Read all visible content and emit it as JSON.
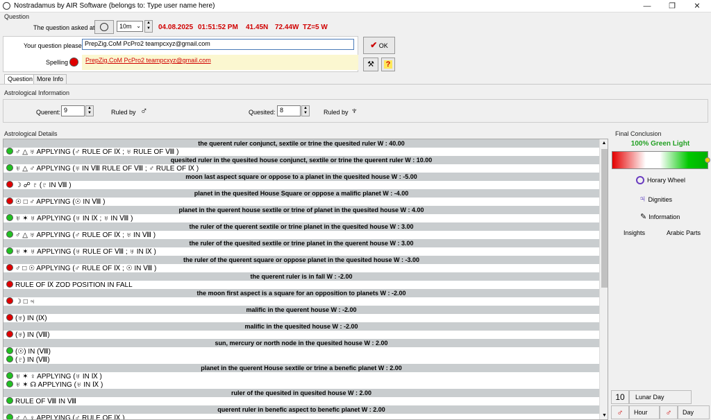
{
  "window": {
    "title": "Nostradamus by AIR Software (belongs to: Type user name here)",
    "min_glyph": "—",
    "max_glyph": "❐",
    "close_glyph": "✕"
  },
  "question": {
    "group_label": "Question",
    "asked_label": "The question asked at",
    "interval_value": "10m",
    "date": "04.08.2025",
    "time": "01:51:52 PM",
    "lat": "41.45N",
    "lon": "72.44W",
    "tz": "TZ=5 W",
    "your_question_label": "Your question please",
    "question_value": "PrepZig.CoM        PcPro2        teampcxyz@gmail.com",
    "spelling_label": "Spelling",
    "spelling_value": "PrepZig.CoM PcPro2 teampcxyz@gmail.com",
    "ok_label": "OK",
    "help_glyph": "?"
  },
  "tabs": {
    "question": "Question",
    "more_info": "More Info"
  },
  "astro_info": {
    "group_label": "Astrological Information",
    "querent_label": "Querent:",
    "querent_value": "9",
    "querent_ruled_label": "Ruled by",
    "querent_ruler_glyph": "♂",
    "quesited_label": "Quesited:",
    "quesited_value": "8",
    "quesited_ruled_label": "Ruled by",
    "quesited_ruler_glyph": "♆"
  },
  "details": {
    "group_label": "Astrological Details",
    "rows": [
      {
        "kind": "rule",
        "text": "the querent ruler conjunct, sextile or trine the quesited ruler  W : 40.00"
      },
      {
        "kind": "app",
        "dot": "green",
        "text": "♂ △ ♅ APPLYING (♂ RULE OF Ⅸ ; ♅ RULE OF Ⅷ )"
      },
      {
        "kind": "rule",
        "text": "quesited ruler in the quesited house conjunct, sextile or trine the querent ruler  W : 10.00"
      },
      {
        "kind": "app",
        "dot": "green",
        "text": "♅ △ ♂ APPLYING (♅ IN Ⅷ RULE OF Ⅷ ; ♂ RULE OF Ⅸ )"
      },
      {
        "kind": "rule",
        "text": "moon last aspect square or oppose to a planet in the quesited house  W : -5.00"
      },
      {
        "kind": "app",
        "dot": "red",
        "text": "☽ ☍ ♇   (♇ IN Ⅷ )"
      },
      {
        "kind": "rule",
        "text": "planet in the quesited House Square or oppose a malific  planet  W : -4.00"
      },
      {
        "kind": "app",
        "dot": "red",
        "text": "☉ □ ♂ APPLYING (☉ IN Ⅷ )"
      },
      {
        "kind": "rule",
        "text": "planet in the querent house sextile or trine of planet in the quesited house  W : 4.00"
      },
      {
        "kind": "app",
        "dot": "green",
        "text": "♅ ✶ ♅ APPLYING (♅ IN Ⅸ ; ♅ IN Ⅷ )"
      },
      {
        "kind": "rule",
        "text": "the ruler of the querent sextile or trine planet in the quesited house  W : 3.00"
      },
      {
        "kind": "app",
        "dot": "green",
        "text": "♂ △ ♅ APPLYING (♂ RULE OF Ⅸ ; ♅ IN Ⅷ )"
      },
      {
        "kind": "rule",
        "text": "the ruler of the quesited sextile or trine planet in the querent house  W : 3.00"
      },
      {
        "kind": "app",
        "dot": "green",
        "text": "♅ ✶ ♅ APPLYING (♅ RULE OF Ⅷ ; ♅ IN Ⅸ )"
      },
      {
        "kind": "rule",
        "text": "the ruler of the querent square or oppose planet in the quesited house  W : -3.00"
      },
      {
        "kind": "app",
        "dot": "red",
        "text": "♂ □ ☉ APPLYING (♂ RULE OF Ⅸ ; ☉ IN Ⅷ )"
      },
      {
        "kind": "rule",
        "text": "the querent ruler is in fall  W : -2.00"
      },
      {
        "kind": "app",
        "dot": "red",
        "text": "RULE OF Ⅸ ZOD POSITION  IN FALL"
      },
      {
        "kind": "rule",
        "text": "the moon first aspect is a square for an opposition to planets  W : -2.00"
      },
      {
        "kind": "app",
        "dot": "red",
        "text": "☽ □ ♃"
      },
      {
        "kind": "rule",
        "text": "malific in the querent house  W : -2.00"
      },
      {
        "kind": "app",
        "dot": "red",
        "text": "(♅) IN (Ⅸ)"
      },
      {
        "kind": "rule",
        "text": "malific in the quesited house  W : -2.00"
      },
      {
        "kind": "app",
        "dot": "red",
        "text": "(♅) IN (Ⅷ)"
      },
      {
        "kind": "rule",
        "text": "sun, mercury or north node in the quesited house  W : 2.00"
      },
      {
        "kind": "app",
        "dot": "green",
        "text": "(☉) IN (Ⅷ)"
      },
      {
        "kind": "app",
        "dot": "green",
        "text": "(♇) IN (Ⅷ)"
      },
      {
        "kind": "rule",
        "text": "planet in the querent House sextile or trine a benefic planet  W : 2.00"
      },
      {
        "kind": "app",
        "dot": "green",
        "text": "♅ ✶ ♀ APPLYING (♅ IN Ⅸ )"
      },
      {
        "kind": "app",
        "dot": "green",
        "text": "♅ ✶ ☊ APPLYING (♅ IN Ⅸ )"
      },
      {
        "kind": "rule",
        "text": "ruler of the quesited in quesited house  W : 2.00"
      },
      {
        "kind": "app",
        "dot": "green",
        "text": "RULE OF Ⅷ IN Ⅷ"
      },
      {
        "kind": "rule",
        "text": "querent ruler in benefic aspect to benefic planet  W : 2.00"
      },
      {
        "kind": "app",
        "dot": "green",
        "text": "♂ △ ♀ APPLYING (♂ RULE OF Ⅸ )"
      }
    ]
  },
  "final": {
    "group_label": "Final Conclusion",
    "verdict": "100% Green Light",
    "gauge_level": 1.0,
    "horary_wheel": "Horary Wheel",
    "dignities": "Dignities",
    "information": "Information",
    "insights": "Insights",
    "arabic_parts": "Arabic Parts",
    "lunar_day_number": "10",
    "lunar_day_label": "Lunar Day",
    "hour_glyph": "♂",
    "hour_label": "Hour",
    "day_glyph": "♂",
    "day_label": "Day"
  },
  "colors": {
    "red_text": "#d00000",
    "green_light": "#22a022",
    "rule_bg": "#c9cdcf"
  }
}
